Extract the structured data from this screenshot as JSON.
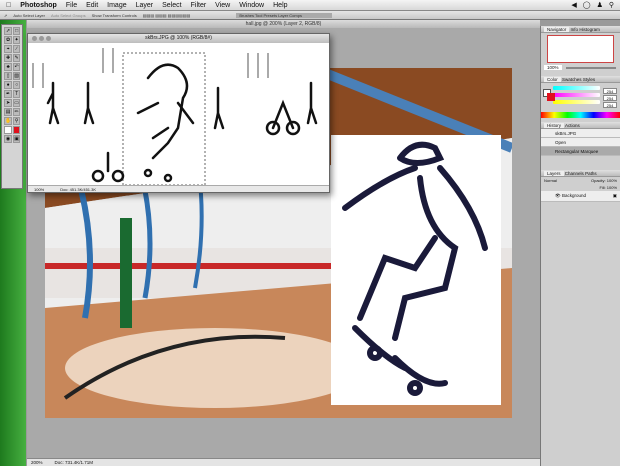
{
  "menubar": {
    "app": "Photoshop",
    "items": [
      "File",
      "Edit",
      "Image",
      "Layer",
      "Select",
      "Filter",
      "View",
      "Window",
      "Help"
    ],
    "status_icons": [
      "volume-icon",
      "sync-icon",
      "user-icon",
      "spotlight-icon"
    ]
  },
  "options": {
    "auto_select": "Auto Select Layer",
    "group": "Auto Select Groups",
    "transform": "Show Transform Controls",
    "workspace": "Brushes  Tool Presets  Layer Comps"
  },
  "main_doc": {
    "title": "hall.jpg @ 200% (Layer 2, RGB/8)",
    "zoom": "200%",
    "doc_size": "Doc: 731.4K/1.71M"
  },
  "small_doc": {
    "title": "skBrs.JPG @ 100% (RGB/8#)",
    "zoom": "100%",
    "doc_size": "Doc: 451.3K/451.3K"
  },
  "navigator": {
    "tabs": [
      "Navigator",
      "Info",
      "Histogram"
    ],
    "zoom": "100%"
  },
  "color": {
    "tabs": [
      "Color",
      "Swatches",
      "Styles"
    ],
    "channels": [
      {
        "name": "R",
        "value": "254"
      },
      {
        "name": "G",
        "value": "254"
      },
      {
        "name": "B",
        "value": "254"
      }
    ],
    "foreground": "#ffffff",
    "background": "#e0101c"
  },
  "history": {
    "tabs": [
      "History",
      "Actions"
    ],
    "items": [
      "skBrs.JPG",
      "Open",
      "Rectangular Marquee"
    ]
  },
  "layers": {
    "tabs": [
      "Layers",
      "Channels",
      "Paths"
    ],
    "blend": "Normal",
    "opacity": "Opacity: 100%",
    "fill": "Fill: 100%",
    "items": [
      "Background"
    ]
  }
}
